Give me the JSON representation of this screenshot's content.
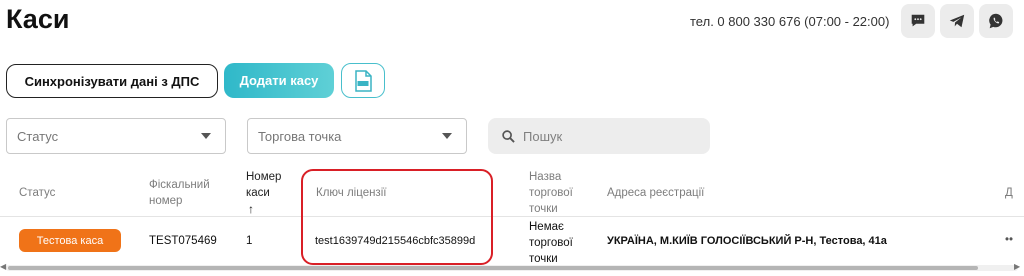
{
  "header": {
    "title": "Каси",
    "phone": "тел. 0 800 330 676 (07:00 - 22:00)",
    "contact_icons": [
      "chat-icon",
      "telegram-icon",
      "viber-icon"
    ]
  },
  "toolbar": {
    "sync_label": "Синхронізувати дані з ДПС",
    "add_label": "Додати касу",
    "export_icon": "xlsx-file-icon"
  },
  "filters": {
    "status_placeholder": "Статус",
    "point_placeholder": "Торгова точка",
    "search_placeholder": "Пошук"
  },
  "table": {
    "columns": {
      "status": "Статус",
      "fiscal_1": "Фіскальний",
      "fiscal_2": "номер",
      "number_1": "Номер",
      "number_2": "каси",
      "sort_arrow": "↑",
      "license": "Ключ ліцензії",
      "point_1": "Назва",
      "point_2": "торгової",
      "point_3": "точки",
      "address": "Адреса реєстрації",
      "extra": "Д"
    },
    "rows": [
      {
        "status": "Тестова каса",
        "fiscal": "TEST075469",
        "number": "1",
        "license": "test1639749d215546cbfc35899d",
        "point_1": "Немає",
        "point_2": "торгової",
        "point_3": "точки",
        "address": "УКРАЇНА, М.КИЇВ ГОЛОСІЇВСЬКИЙ Р-Н, Тестова, 41а",
        "more": "••"
      }
    ]
  },
  "colors": {
    "accent": "#2fb8c9",
    "badge": "#f07318",
    "highlight": "#d91f26"
  }
}
